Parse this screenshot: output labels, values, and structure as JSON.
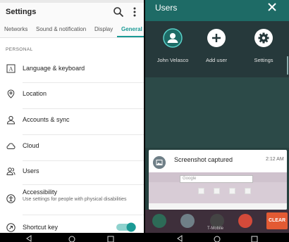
{
  "left": {
    "appbar": {
      "title": "Settings",
      "search_icon": "search-icon",
      "more_icon": "overflow-menu-icon"
    },
    "tabs": [
      {
        "label": "Networks",
        "active": false
      },
      {
        "label": "Sound & notification",
        "active": false
      },
      {
        "label": "Display",
        "active": false
      },
      {
        "label": "General",
        "active": true
      }
    ],
    "section": "PERSONAL",
    "items": [
      {
        "label": "Language & keyboard",
        "icon": "keyboard-icon"
      },
      {
        "label": "Location",
        "icon": "location-pin-icon"
      },
      {
        "label": "Accounts & sync",
        "icon": "account-icon"
      },
      {
        "label": "Cloud",
        "icon": "cloud-icon"
      },
      {
        "label": "Users",
        "icon": "users-icon"
      },
      {
        "label": "Accessibility",
        "subtitle": "Use settings for people with physical disabilities",
        "icon": "accessibility-icon"
      },
      {
        "label": "Shortcut key",
        "icon": "shortcut-key-icon",
        "toggle": true
      }
    ],
    "accent": "#1a9a95"
  },
  "right": {
    "users_bar": {
      "title": "Users",
      "close_icon": "close-icon"
    },
    "users": [
      {
        "name": "John Velasco",
        "icon": "user-avatar-icon"
      },
      {
        "name": "Add user",
        "icon": "add-icon"
      },
      {
        "name": "Settings",
        "icon": "gear-icon"
      }
    ],
    "notification": {
      "title": "Screenshot captured",
      "time": "2:12 AM",
      "preview_search": "Google"
    },
    "dock": {
      "clear_label": "CLEAR",
      "carrier": "T-Mobile"
    },
    "colors": {
      "bar": "#1e6b66",
      "panel": "#26393b",
      "clear": "#e35a33"
    }
  }
}
